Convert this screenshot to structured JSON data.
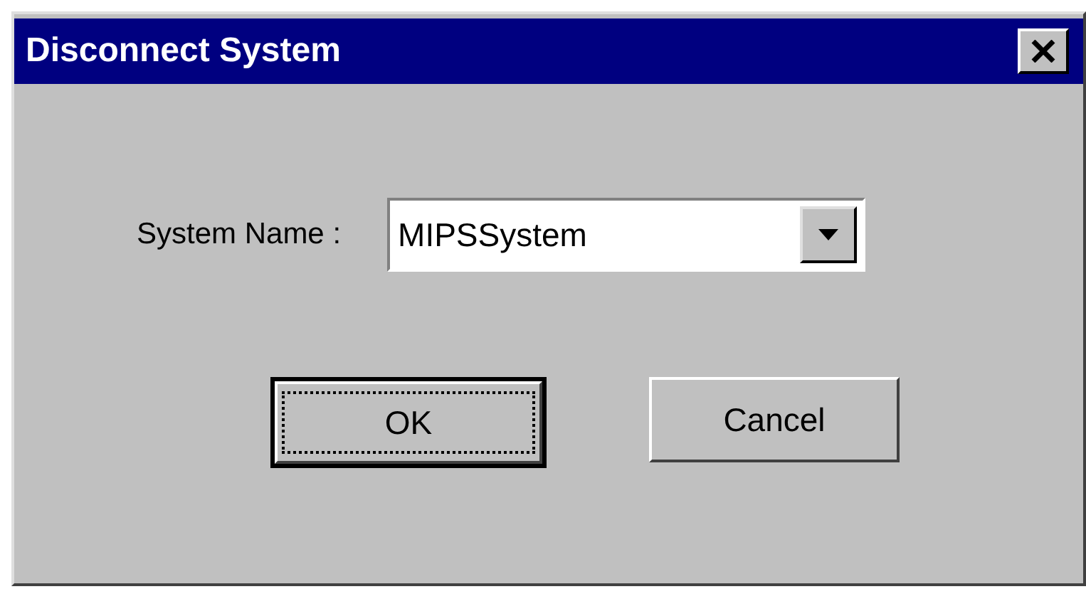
{
  "window": {
    "title": "Disconnect System"
  },
  "field": {
    "label": "System Name :",
    "value": "MIPSSystem"
  },
  "buttons": [
    {
      "label": "OK",
      "default": true
    },
    {
      "label": "Cancel",
      "default": false
    }
  ]
}
